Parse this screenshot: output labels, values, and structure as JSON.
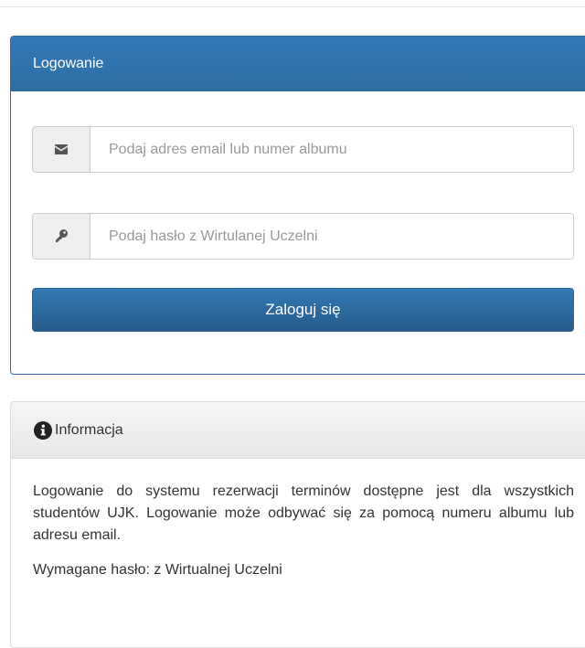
{
  "login": {
    "title": "Logowanie",
    "email_placeholder": "Podaj adres email lub numer albumu",
    "password_placeholder": "Podaj hasło z Wirtulanej Uczelni",
    "submit_label": "Zaloguj się",
    "email_icon": "envelope-icon",
    "password_icon": "key-icon"
  },
  "info": {
    "title": "Informacja",
    "icon": "info-circle-icon",
    "paragraph": "Logowanie do systemu rezerwacji terminów dostępne jest dla wszystkich studentów UJK. Logowanie może odbywać się za pomocą numeru albumu lub adresu email.",
    "requirement": "Wymagane hasło: z Wirtualnej Uczelni"
  },
  "colors": {
    "primary": "#337ab7",
    "primary_dark": "#265a88",
    "border": "#cccccc",
    "addon_bg": "#eeeeee"
  }
}
